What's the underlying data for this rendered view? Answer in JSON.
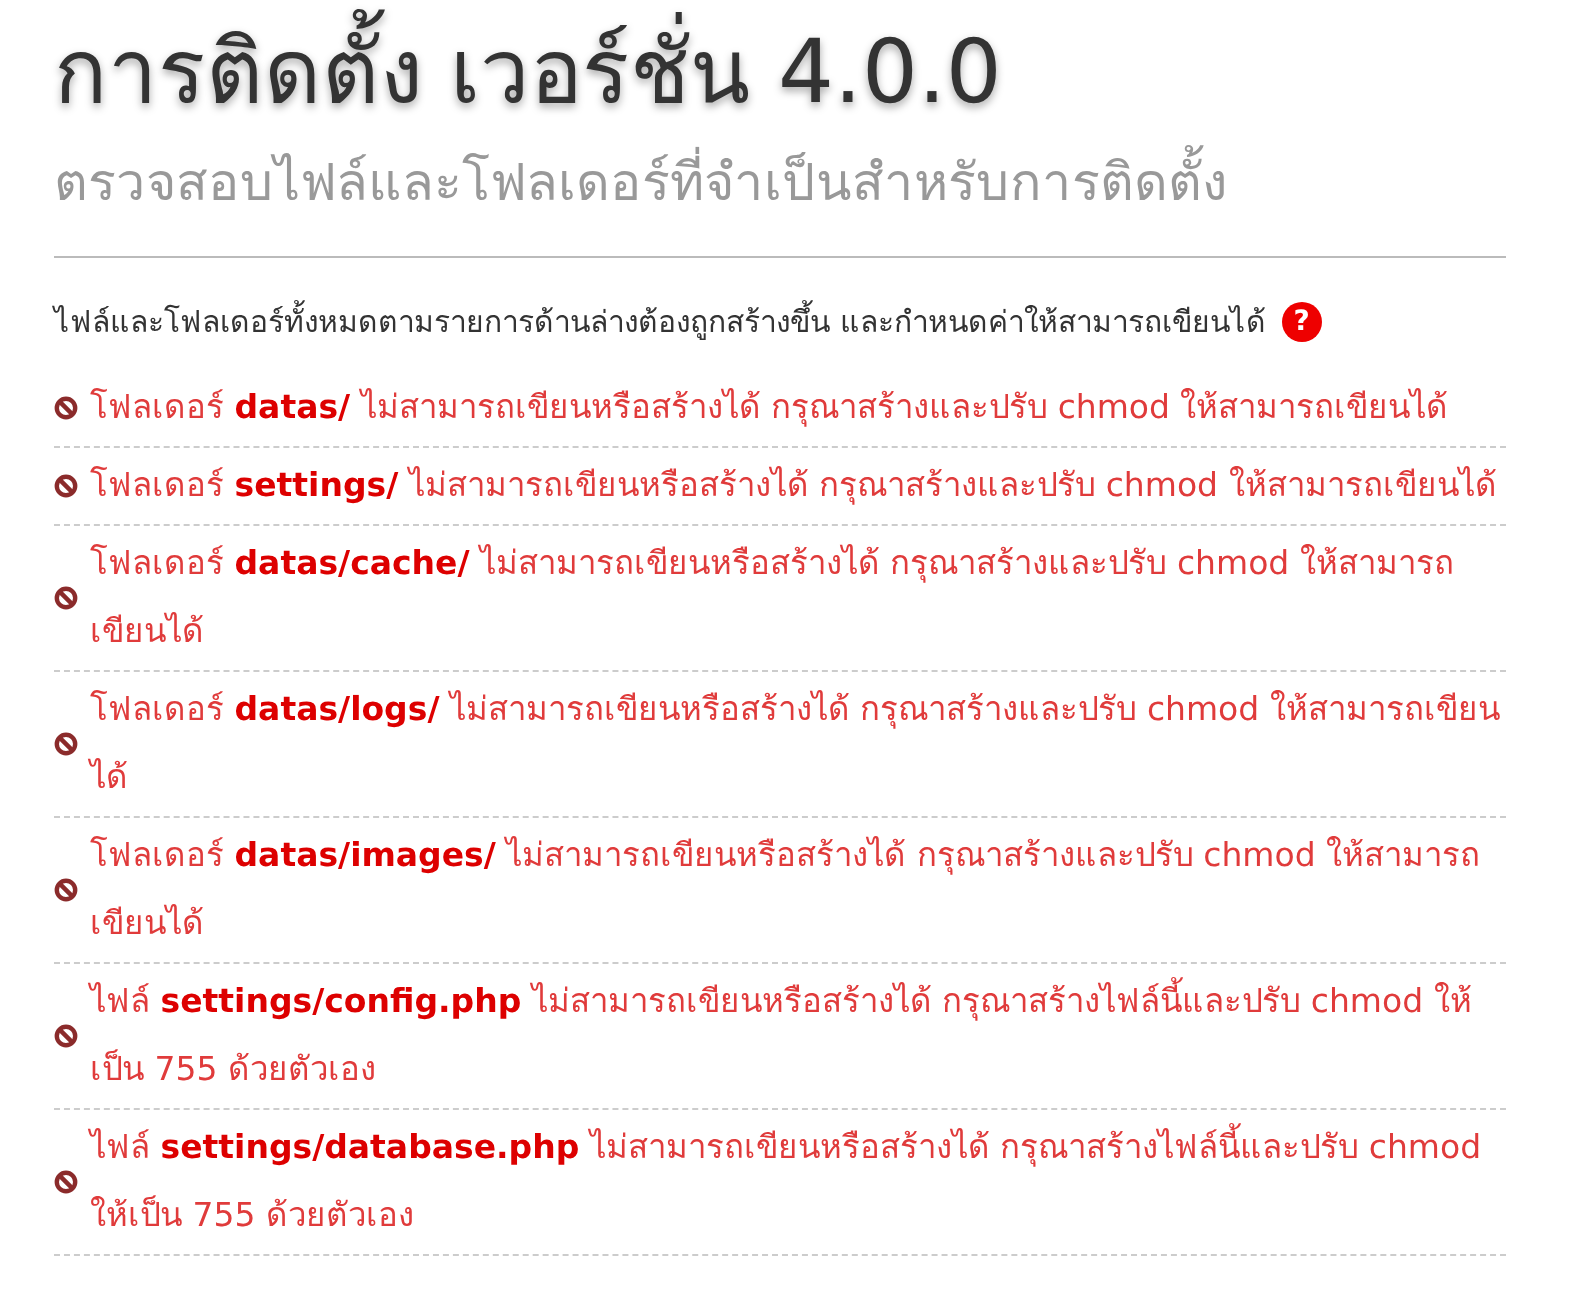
{
  "title": "การติดตั้ง เวอร์ชั่น 4.0.0",
  "subtitle": "ตรวจสอบไฟล์และโฟลเดอร์ที่จำเป็นสำหรับการติดตั้ง",
  "intro": {
    "text": "ไฟล์และโฟลเดอร์ทั้งหมดตามรายการด้านล่างต้องถูกสร้างขึ้น และกำหนดค่าให้สามารถเขียนได้",
    "help": "?"
  },
  "items": [
    {
      "text": "โฟลเดอร์ **datas/** ไม่สามารถเขียนหรือสร้างได้ กรุณาสร้างและปรับ chmod ให้สามารถเขียนได้"
    },
    {
      "text": "โฟลเดอร์ **settings/** ไม่สามารถเขียนหรือสร้างได้ กรุณาสร้างและปรับ chmod ให้สามารถเขียนได้"
    },
    {
      "text": "โฟลเดอร์ **datas/cache/** ไม่สามารถเขียนหรือสร้างได้ กรุณาสร้างและปรับ chmod ให้สามารถเขียนได้"
    },
    {
      "text": "โฟลเดอร์ **datas/logs/** ไม่สามารถเขียนหรือสร้างได้ กรุณาสร้างและปรับ chmod ให้สามารถเขียนได้"
    },
    {
      "text": "โฟลเดอร์ **datas/images/** ไม่สามารถเขียนหรือสร้างได้ กรุณาสร้างและปรับ chmod ให้สามารถเขียนได้"
    },
    {
      "text": "ไฟล์ **settings/config.php** ไม่สามารถเขียนหรือสร้างได้ กรุณาสร้างไฟล์นี้และปรับ chmod ให้เป็น 755 ด้วยตัวเอง"
    },
    {
      "text": "ไฟล์ **settings/database.php** ไม่สามารถเขียนหรือสร้างได้ กรุณาสร้างไฟล์นี้และปรับ chmod ให้เป็น 755 ด้วยตัวเอง"
    }
  ]
}
